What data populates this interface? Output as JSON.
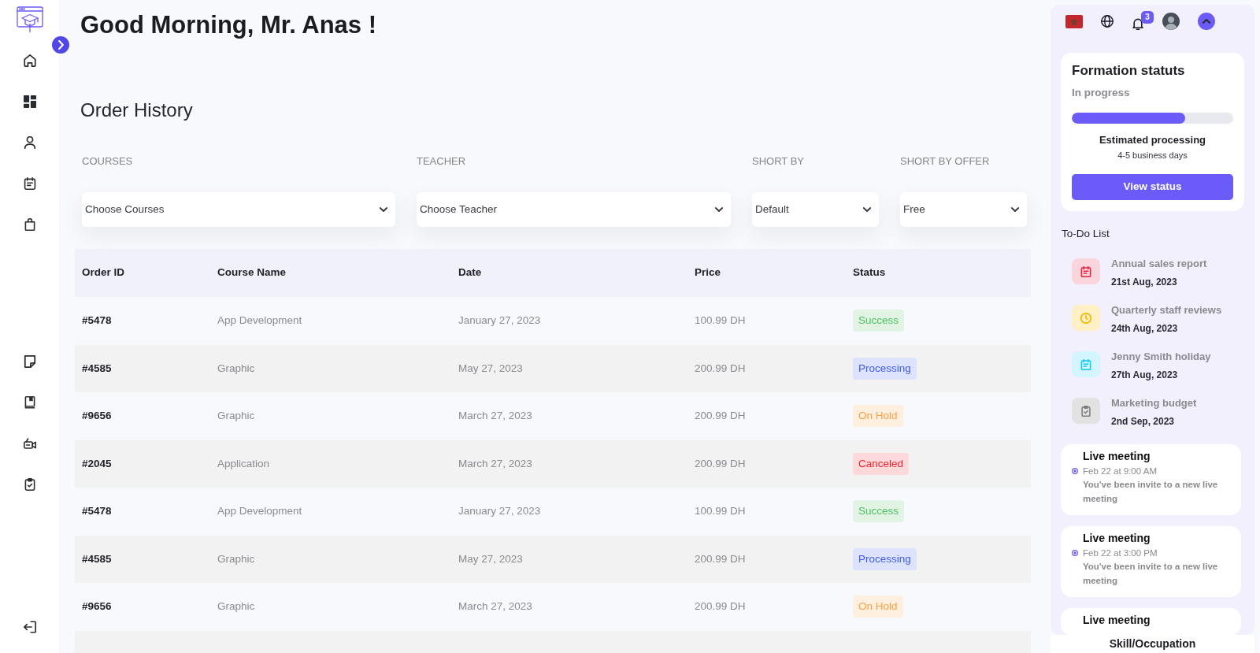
{
  "greeting": "Good Morning, Mr. Anas !",
  "order_history": {
    "title": "Order History",
    "filters": [
      {
        "label": "COURSES",
        "value": "Choose Courses"
      },
      {
        "label": "TEACHER",
        "value": "Choose Teacher"
      },
      {
        "label": "SHORT BY",
        "value": "Default"
      },
      {
        "label": "SHORT BY OFFER",
        "value": "Free"
      }
    ],
    "table": {
      "columns": [
        "Order ID",
        "Course Name",
        "Date",
        "Price",
        "Status"
      ],
      "rows": [
        {
          "order_id": "#5478",
          "course_name": "App Development",
          "date": "January 27, 2023",
          "price": "100.99 DH",
          "status": {
            "label": "Success",
            "color": "#4cbf5f"
          }
        },
        {
          "order_id": "#4585",
          "course_name": "Graphic",
          "date": "May 27, 2023",
          "price": "200.99 DH",
          "status": {
            "label": "Processing",
            "color": "#3d5af1"
          }
        },
        {
          "order_id": "#9656",
          "course_name": "Graphic",
          "date": "March 27, 2023",
          "price": "200.99 DH",
          "status": {
            "label": "On Hold",
            "color": "#ff9f43"
          }
        },
        {
          "order_id": "#2045",
          "course_name": "Application",
          "date": "March 27, 2023",
          "price": "200.99 DH",
          "status": {
            "label": "Canceled",
            "color": "#f5222d"
          }
        },
        {
          "order_id": "#5478",
          "course_name": "App Development",
          "date": "January 27, 2023",
          "price": "100.99 DH",
          "status": {
            "label": "Success",
            "color": "#4cbf5f"
          }
        },
        {
          "order_id": "#4585",
          "course_name": "Graphic",
          "date": "May 27, 2023",
          "price": "200.99 DH",
          "status": {
            "label": "Processing",
            "color": "#3d5af1"
          }
        },
        {
          "order_id": "#9656",
          "course_name": "Graphic",
          "date": "March 27, 2023",
          "price": "200.99 DH",
          "status": {
            "label": "On Hold",
            "color": "#ff9f43"
          }
        }
      ]
    }
  },
  "notifications": {
    "count": "3"
  },
  "formation_status": {
    "title": "Formation statuts",
    "status": "In progress",
    "level": 0.7,
    "estimate_label": "Estimated processing",
    "estimate": "4-5 business days",
    "button": "View status"
  },
  "todo": {
    "title": "To-Do List",
    "items": [
      {
        "title": "Annual sales report",
        "date": "21st Aug, 2023",
        "color": "#fad5db"
      },
      {
        "title": "Quarterly staff reviews",
        "date": "24th Aug, 2023",
        "color": "#fff0c5"
      },
      {
        "title": "Jenny Smith holiday",
        "date": "27th Aug, 2023",
        "color": "#d3f5fd"
      },
      {
        "title": "Marketing budget",
        "date": "2nd Sep, 2023",
        "color": "#e2e2e2"
      }
    ]
  },
  "meetings": [
    {
      "title": "Live meeting",
      "time": "Feb 22 at 9:00 AM",
      "message": "You've been invite to a new live meeting"
    },
    {
      "title": "Live meeting",
      "time": "Feb 22 at 3:00 PM",
      "message": "You've been invite to a new live meeting"
    },
    {
      "title": "Live meeting"
    }
  ],
  "bottom_tab": "Skill/Occupation"
}
